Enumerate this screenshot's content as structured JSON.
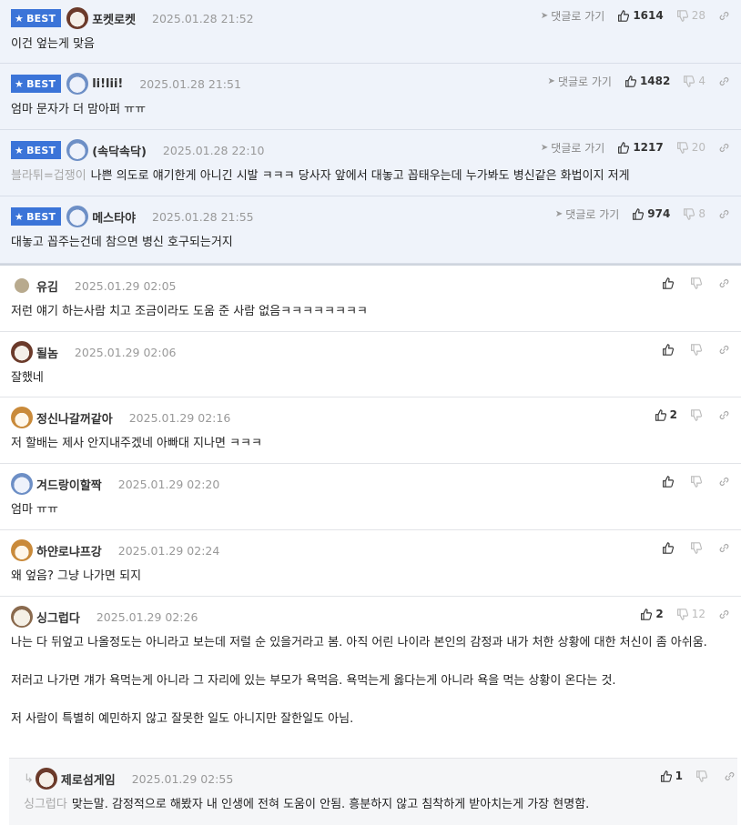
{
  "best_badge_label": "BEST",
  "reply_link_label": "댓글로 가기",
  "colors": {
    "badge": "#3b74d8",
    "best_bg": "#eff3fa"
  },
  "best_comments": [
    {
      "nick": "포켓로켓",
      "time": "2025.01.28 21:52",
      "up": "1614",
      "down": "28",
      "ref": "",
      "text": "이건 엎는게 맞음",
      "avatar": "dog-icon"
    },
    {
      "nick": "li!lii!",
      "time": "2025.01.28 21:51",
      "up": "1482",
      "down": "4",
      "ref": "",
      "text": "엄마 문자가 더 맘아퍼 ㅠㅠ",
      "avatar": "character-icon"
    },
    {
      "nick": "(속닥속닥)",
      "time": "2025.01.28 22:10",
      "up": "1217",
      "down": "20",
      "ref": "블라튀=겁쟁이",
      "text": "나쁜 의도로 얘기한게 아니긴 시발 ㅋㅋㅋ 당사자 앞에서 대놓고 꼽태우는데 누가봐도 병신같은 화법이지 저게",
      "avatar": "character-icon"
    },
    {
      "nick": "메스타야",
      "time": "2025.01.28 21:55",
      "up": "974",
      "down": "8",
      "ref": "",
      "text": "대놓고 꼽주는건데 참으면 병신 호구되는거지",
      "avatar": "character-icon"
    }
  ],
  "comments": [
    {
      "nick": "유김",
      "time": "2025.01.29 02:05",
      "up": "",
      "down": "",
      "text": "저런 얘기 하는사람 치고 조금이라도 도움 준 사람 없음ㅋㅋㅋㅋㅋㅋㅋㅋ",
      "avatar": "dot-icon"
    },
    {
      "nick": "될놈",
      "time": "2025.01.29 02:06",
      "up": "",
      "down": "",
      "text": "잘했네",
      "avatar": "dog-icon"
    },
    {
      "nick": "정신나갈꺼같아",
      "time": "2025.01.29 02:16",
      "up": "2",
      "down": "",
      "text": "저 할배는 제사 안지내주겠네 아빠대 지나면 ㅋㅋㅋ",
      "avatar": "fox-icon"
    },
    {
      "nick": "겨드랑이할짝",
      "time": "2025.01.29 02:20",
      "up": "",
      "down": "",
      "text": "엄마 ㅠㅠ",
      "avatar": "character-icon"
    },
    {
      "nick": "하얀로냐프강",
      "time": "2025.01.29 02:24",
      "up": "",
      "down": "",
      "text": "왜 엎음? 그냥 나가면 되지",
      "avatar": "fox-icon"
    },
    {
      "nick": "싱그럽다",
      "time": "2025.01.29 02:26",
      "up": "2",
      "down": "12",
      "paragraphs": [
        "나는 다 뒤엎고 나올정도는 아니라고 보는데 저럴 순 있을거라고 봄. 아직 어린 나이라 본인의 감정과 내가 처한 상황에 대한 처신이 좀 아쉬움.",
        "저러고 나가면 걔가 욕먹는게 아니라 그 자리에 있는 부모가 욕먹음. 욕먹는게 옳다는게 아니라 욕을 먹는 상황이 온다는 것.",
        "저 사람이 특별히 예민하지 않고 잘못한 일도 아니지만 잘한일도 아님."
      ],
      "avatar": "sheep-icon"
    }
  ],
  "reply": {
    "nick": "제로섬게임",
    "time": "2025.01.29 02:55",
    "up": "1",
    "down": "",
    "ref": "싱그럽다",
    "text": "맞는말. 감정적으로 해봤자 내 인생에 전혀 도움이 안됨. 흥분하지 않고 침착하게 받아치는게 가장 현명함.",
    "avatar": "dog-icon"
  }
}
